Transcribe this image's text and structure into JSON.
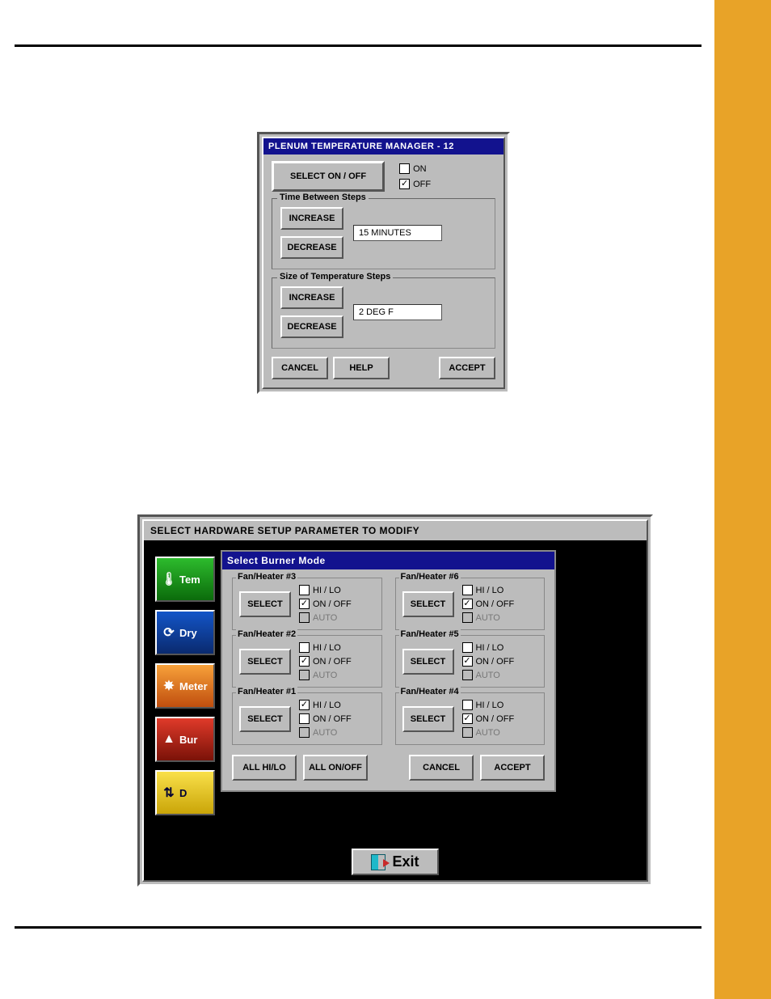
{
  "win1": {
    "title": "PLENUM TEMPERATURE MANAGER - 12",
    "select_onoff": "SELECT ON / OFF",
    "on_label": "ON",
    "off_label": "OFF",
    "on_checked": false,
    "off_checked": true,
    "time_legend": "Time Between Steps",
    "increase": "INCREASE",
    "decrease": "DECREASE",
    "time_value": "15 MINUTES",
    "size_legend": "Size of Temperature Steps",
    "size_value": "2 DEG F",
    "cancel": "CANCEL",
    "help": "HELP",
    "accept": "ACCEPT"
  },
  "win2": {
    "title": "SELECT HARDWARE SETUP PARAMETER TO MODIFY",
    "sidebar": [
      {
        "label": "Tem",
        "class": "green",
        "icon": "🌡"
      },
      {
        "label": "Dry",
        "class": "blue",
        "icon": "⟳"
      },
      {
        "label": "Meter",
        "class": "orange",
        "icon": "✸"
      },
      {
        "label": "Bur",
        "class": "red",
        "icon": "▲"
      },
      {
        "label": "D",
        "class": "yellow",
        "icon": "⇅"
      }
    ],
    "modal": {
      "title": "Select Burner Mode",
      "select": "SELECT",
      "hilo": "HI / LO",
      "onoff": "ON / OFF",
      "auto": "AUTO",
      "groups": [
        {
          "legend": "Fan/Heater #3",
          "hilo": false,
          "onoff": true,
          "auto": false
        },
        {
          "legend": "Fan/Heater #6",
          "hilo": false,
          "onoff": true,
          "auto": false
        },
        {
          "legend": "Fan/Heater #2",
          "hilo": false,
          "onoff": true,
          "auto": false
        },
        {
          "legend": "Fan/Heater #5",
          "hilo": false,
          "onoff": true,
          "auto": false
        },
        {
          "legend": "Fan/Heater #1",
          "hilo": true,
          "onoff": false,
          "auto": false
        },
        {
          "legend": "Fan/Heater #4",
          "hilo": false,
          "onoff": true,
          "auto": false
        }
      ],
      "all_hilo": "ALL HI/LO",
      "all_onoff": "ALL ON/OFF",
      "cancel": "CANCEL",
      "accept": "ACCEPT"
    },
    "exit": "Exit"
  }
}
